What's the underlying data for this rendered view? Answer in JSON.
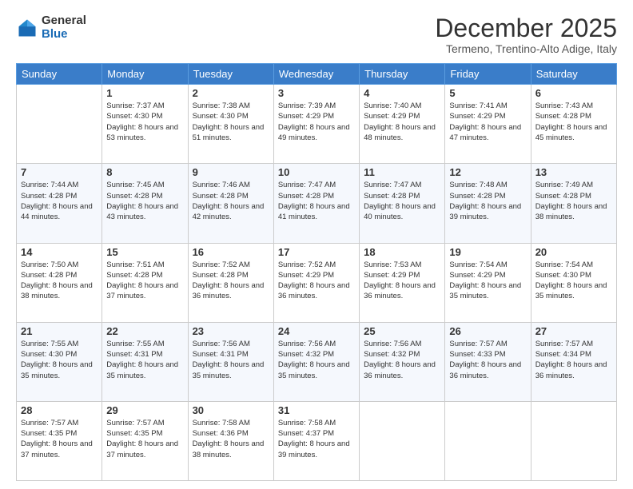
{
  "logo": {
    "general": "General",
    "blue": "Blue"
  },
  "title": "December 2025",
  "subtitle": "Termeno, Trentino-Alto Adige, Italy",
  "days_of_week": [
    "Sunday",
    "Monday",
    "Tuesday",
    "Wednesday",
    "Thursday",
    "Friday",
    "Saturday"
  ],
  "weeks": [
    [
      {
        "day": "",
        "sunrise": "",
        "sunset": "",
        "daylight": ""
      },
      {
        "day": "1",
        "sunrise": "Sunrise: 7:37 AM",
        "sunset": "Sunset: 4:30 PM",
        "daylight": "Daylight: 8 hours and 53 minutes."
      },
      {
        "day": "2",
        "sunrise": "Sunrise: 7:38 AM",
        "sunset": "Sunset: 4:30 PM",
        "daylight": "Daylight: 8 hours and 51 minutes."
      },
      {
        "day": "3",
        "sunrise": "Sunrise: 7:39 AM",
        "sunset": "Sunset: 4:29 PM",
        "daylight": "Daylight: 8 hours and 49 minutes."
      },
      {
        "day": "4",
        "sunrise": "Sunrise: 7:40 AM",
        "sunset": "Sunset: 4:29 PM",
        "daylight": "Daylight: 8 hours and 48 minutes."
      },
      {
        "day": "5",
        "sunrise": "Sunrise: 7:41 AM",
        "sunset": "Sunset: 4:29 PM",
        "daylight": "Daylight: 8 hours and 47 minutes."
      },
      {
        "day": "6",
        "sunrise": "Sunrise: 7:43 AM",
        "sunset": "Sunset: 4:28 PM",
        "daylight": "Daylight: 8 hours and 45 minutes."
      }
    ],
    [
      {
        "day": "7",
        "sunrise": "Sunrise: 7:44 AM",
        "sunset": "Sunset: 4:28 PM",
        "daylight": "Daylight: 8 hours and 44 minutes."
      },
      {
        "day": "8",
        "sunrise": "Sunrise: 7:45 AM",
        "sunset": "Sunset: 4:28 PM",
        "daylight": "Daylight: 8 hours and 43 minutes."
      },
      {
        "day": "9",
        "sunrise": "Sunrise: 7:46 AM",
        "sunset": "Sunset: 4:28 PM",
        "daylight": "Daylight: 8 hours and 42 minutes."
      },
      {
        "day": "10",
        "sunrise": "Sunrise: 7:47 AM",
        "sunset": "Sunset: 4:28 PM",
        "daylight": "Daylight: 8 hours and 41 minutes."
      },
      {
        "day": "11",
        "sunrise": "Sunrise: 7:47 AM",
        "sunset": "Sunset: 4:28 PM",
        "daylight": "Daylight: 8 hours and 40 minutes."
      },
      {
        "day": "12",
        "sunrise": "Sunrise: 7:48 AM",
        "sunset": "Sunset: 4:28 PM",
        "daylight": "Daylight: 8 hours and 39 minutes."
      },
      {
        "day": "13",
        "sunrise": "Sunrise: 7:49 AM",
        "sunset": "Sunset: 4:28 PM",
        "daylight": "Daylight: 8 hours and 38 minutes."
      }
    ],
    [
      {
        "day": "14",
        "sunrise": "Sunrise: 7:50 AM",
        "sunset": "Sunset: 4:28 PM",
        "daylight": "Daylight: 8 hours and 38 minutes."
      },
      {
        "day": "15",
        "sunrise": "Sunrise: 7:51 AM",
        "sunset": "Sunset: 4:28 PM",
        "daylight": "Daylight: 8 hours and 37 minutes."
      },
      {
        "day": "16",
        "sunrise": "Sunrise: 7:52 AM",
        "sunset": "Sunset: 4:28 PM",
        "daylight": "Daylight: 8 hours and 36 minutes."
      },
      {
        "day": "17",
        "sunrise": "Sunrise: 7:52 AM",
        "sunset": "Sunset: 4:29 PM",
        "daylight": "Daylight: 8 hours and 36 minutes."
      },
      {
        "day": "18",
        "sunrise": "Sunrise: 7:53 AM",
        "sunset": "Sunset: 4:29 PM",
        "daylight": "Daylight: 8 hours and 36 minutes."
      },
      {
        "day": "19",
        "sunrise": "Sunrise: 7:54 AM",
        "sunset": "Sunset: 4:29 PM",
        "daylight": "Daylight: 8 hours and 35 minutes."
      },
      {
        "day": "20",
        "sunrise": "Sunrise: 7:54 AM",
        "sunset": "Sunset: 4:30 PM",
        "daylight": "Daylight: 8 hours and 35 minutes."
      }
    ],
    [
      {
        "day": "21",
        "sunrise": "Sunrise: 7:55 AM",
        "sunset": "Sunset: 4:30 PM",
        "daylight": "Daylight: 8 hours and 35 minutes."
      },
      {
        "day": "22",
        "sunrise": "Sunrise: 7:55 AM",
        "sunset": "Sunset: 4:31 PM",
        "daylight": "Daylight: 8 hours and 35 minutes."
      },
      {
        "day": "23",
        "sunrise": "Sunrise: 7:56 AM",
        "sunset": "Sunset: 4:31 PM",
        "daylight": "Daylight: 8 hours and 35 minutes."
      },
      {
        "day": "24",
        "sunrise": "Sunrise: 7:56 AM",
        "sunset": "Sunset: 4:32 PM",
        "daylight": "Daylight: 8 hours and 35 minutes."
      },
      {
        "day": "25",
        "sunrise": "Sunrise: 7:56 AM",
        "sunset": "Sunset: 4:32 PM",
        "daylight": "Daylight: 8 hours and 36 minutes."
      },
      {
        "day": "26",
        "sunrise": "Sunrise: 7:57 AM",
        "sunset": "Sunset: 4:33 PM",
        "daylight": "Daylight: 8 hours and 36 minutes."
      },
      {
        "day": "27",
        "sunrise": "Sunrise: 7:57 AM",
        "sunset": "Sunset: 4:34 PM",
        "daylight": "Daylight: 8 hours and 36 minutes."
      }
    ],
    [
      {
        "day": "28",
        "sunrise": "Sunrise: 7:57 AM",
        "sunset": "Sunset: 4:35 PM",
        "daylight": "Daylight: 8 hours and 37 minutes."
      },
      {
        "day": "29",
        "sunrise": "Sunrise: 7:57 AM",
        "sunset": "Sunset: 4:35 PM",
        "daylight": "Daylight: 8 hours and 37 minutes."
      },
      {
        "day": "30",
        "sunrise": "Sunrise: 7:58 AM",
        "sunset": "Sunset: 4:36 PM",
        "daylight": "Daylight: 8 hours and 38 minutes."
      },
      {
        "day": "31",
        "sunrise": "Sunrise: 7:58 AM",
        "sunset": "Sunset: 4:37 PM",
        "daylight": "Daylight: 8 hours and 39 minutes."
      },
      {
        "day": "",
        "sunrise": "",
        "sunset": "",
        "daylight": ""
      },
      {
        "day": "",
        "sunrise": "",
        "sunset": "",
        "daylight": ""
      },
      {
        "day": "",
        "sunrise": "",
        "sunset": "",
        "daylight": ""
      }
    ]
  ]
}
